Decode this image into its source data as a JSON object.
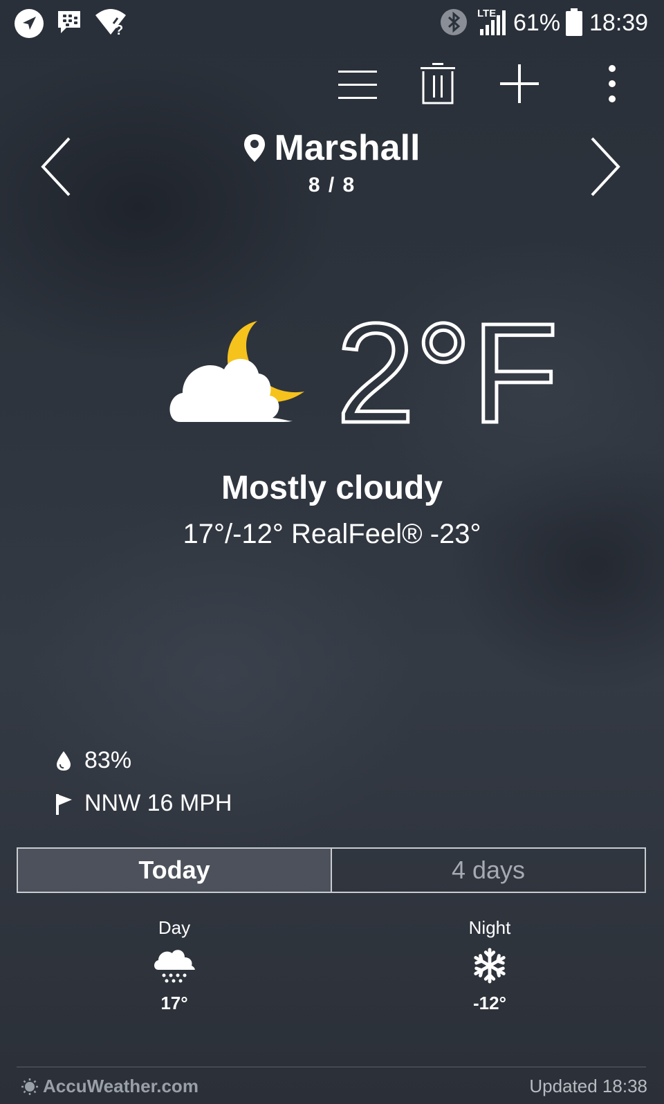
{
  "status_bar": {
    "network_label": "LTE",
    "battery": "61%",
    "time": "18:39",
    "icons": [
      "navigation-icon",
      "bbm-icon",
      "wifi-unknown-icon",
      "bluetooth-icon",
      "signal-icon",
      "battery-icon"
    ]
  },
  "toolbar": {
    "icons": [
      "menu-icon",
      "delete-icon",
      "add-icon",
      "more-icon"
    ]
  },
  "location": {
    "city": "Marshall",
    "page_indicator": "8 / 8"
  },
  "current": {
    "temperature": "2",
    "unit": "°F",
    "condition": "Mostly cloudy",
    "hi_lo_realfeel": "17°/-12° RealFeel® -23°",
    "icon": "moon-cloud-icon",
    "humidity": "83%",
    "wind": "NNW 16 MPH"
  },
  "tabs": [
    {
      "label": "Today",
      "active": true
    },
    {
      "label": "4 days",
      "active": false
    }
  ],
  "forecast": {
    "day": {
      "label": "Day",
      "temp": "17°",
      "icon": "snow-cloud-icon"
    },
    "night": {
      "label": "Night",
      "temp": "-12°",
      "icon": "snowflake-icon"
    }
  },
  "footer": {
    "brand": "AccuWeather.com",
    "updated": "Updated 18:38"
  },
  "colors": {
    "moon": "#f6c21c",
    "inactive_tab_text": "#a6abb3",
    "footer_text": "#b8bcc2"
  }
}
